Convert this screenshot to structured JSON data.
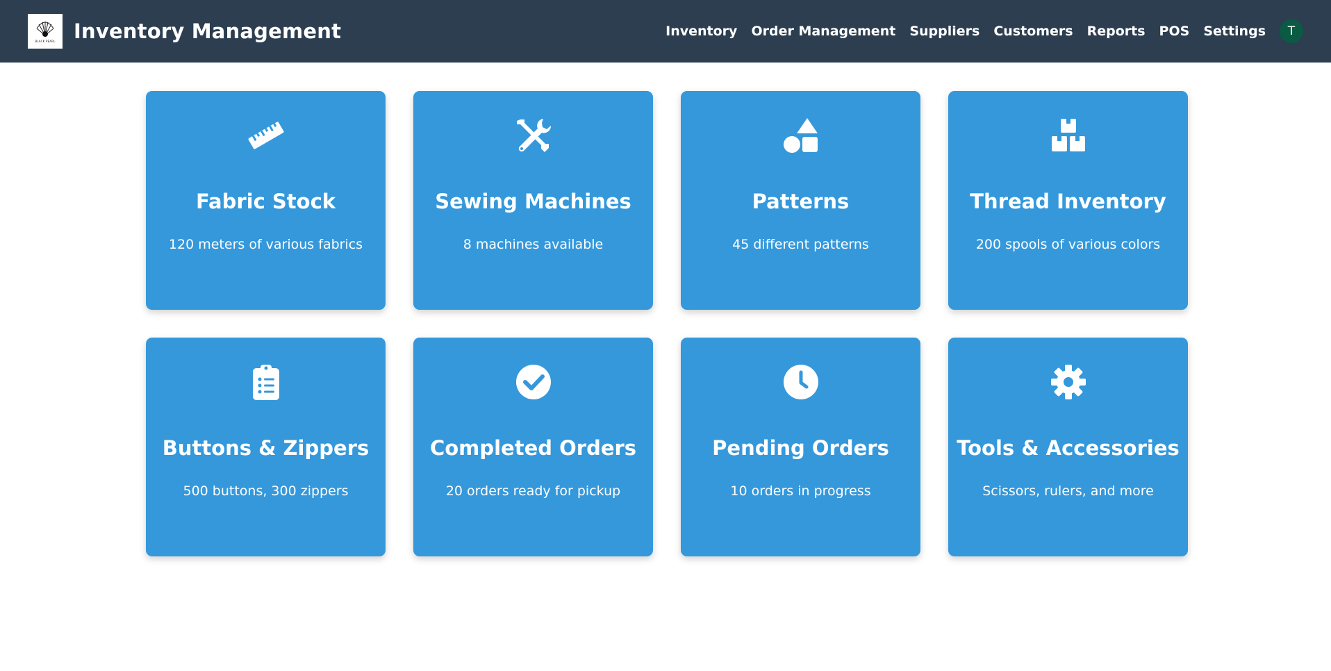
{
  "header": {
    "logo_text": "BLACK PEARL",
    "title": "Inventory Management",
    "nav": [
      {
        "label": "Inventory"
      },
      {
        "label": "Order Management"
      },
      {
        "label": "Suppliers"
      },
      {
        "label": "Customers"
      },
      {
        "label": "Reports"
      },
      {
        "label": "POS"
      },
      {
        "label": "Settings"
      }
    ],
    "avatar_initial": "T"
  },
  "cards": [
    {
      "icon": "ruler-icon",
      "title": "Fabric Stock",
      "description": "120 meters of various fabrics"
    },
    {
      "icon": "tools-icon",
      "title": "Sewing Machines",
      "description": "8 machines available"
    },
    {
      "icon": "shapes-icon",
      "title": "Patterns",
      "description": "45 different patterns"
    },
    {
      "icon": "boxes-icon",
      "title": "Thread Inventory",
      "description": "200 spools of various colors"
    },
    {
      "icon": "clipboard-list-icon",
      "title": "Buttons & Zippers",
      "description": "500 buttons, 300 zippers"
    },
    {
      "icon": "check-circle-icon",
      "title": "Completed Orders",
      "description": "20 orders ready for pickup"
    },
    {
      "icon": "clock-icon",
      "title": "Pending Orders",
      "description": "10 orders in progress"
    },
    {
      "icon": "gear-icon",
      "title": "Tools & Accessories",
      "description": "Scissors, rulers, and more"
    }
  ],
  "colors": {
    "navbar": "#2c3e50",
    "card": "#3498db",
    "avatar": "#0b5a43"
  }
}
